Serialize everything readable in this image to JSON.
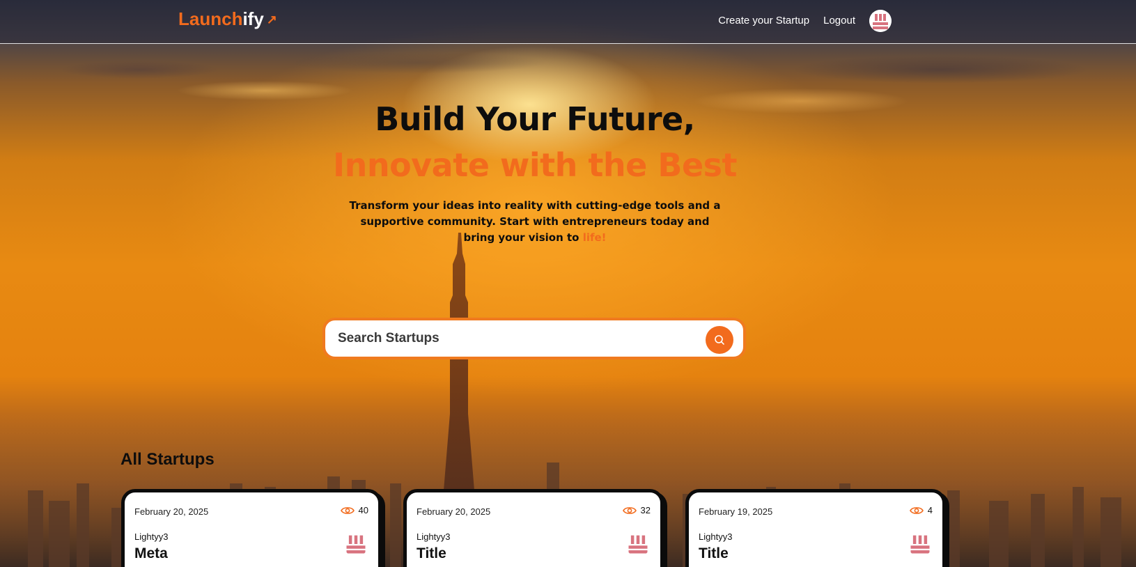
{
  "header": {
    "logo_part1": "Launch",
    "logo_part2": "ify",
    "nav": {
      "create_label": "Create your Startup",
      "logout_label": "Logout"
    }
  },
  "hero": {
    "title_line1": "Build Your Future,",
    "title_line2": "Innovate with the Best",
    "subtitle": "Transform your ideas into reality with cutting-edge tools and a supportive community. Start with entrepreneurs today and bring your vision to ",
    "subtitle_highlight": "life!"
  },
  "search": {
    "placeholder": "Search Startups"
  },
  "section": {
    "title": "All Startups"
  },
  "cards": [
    {
      "date": "February 20, 2025",
      "views": "40",
      "author": "Lightyy3",
      "title": "Meta"
    },
    {
      "date": "February 20, 2025",
      "views": "32",
      "author": "Lightyy3",
      "title": "Title"
    },
    {
      "date": "February 19, 2025",
      "views": "4",
      "author": "Lightyy3",
      "title": "Title"
    }
  ],
  "colors": {
    "accent": "#f26b1d",
    "text_dark": "#0d0d0d",
    "card_border": "#0b0b0b"
  },
  "icons": {
    "logo_arrow": "arrow-up-right-icon",
    "search": "search-icon",
    "views": "eye-icon",
    "avatar": "avatar-icon"
  }
}
